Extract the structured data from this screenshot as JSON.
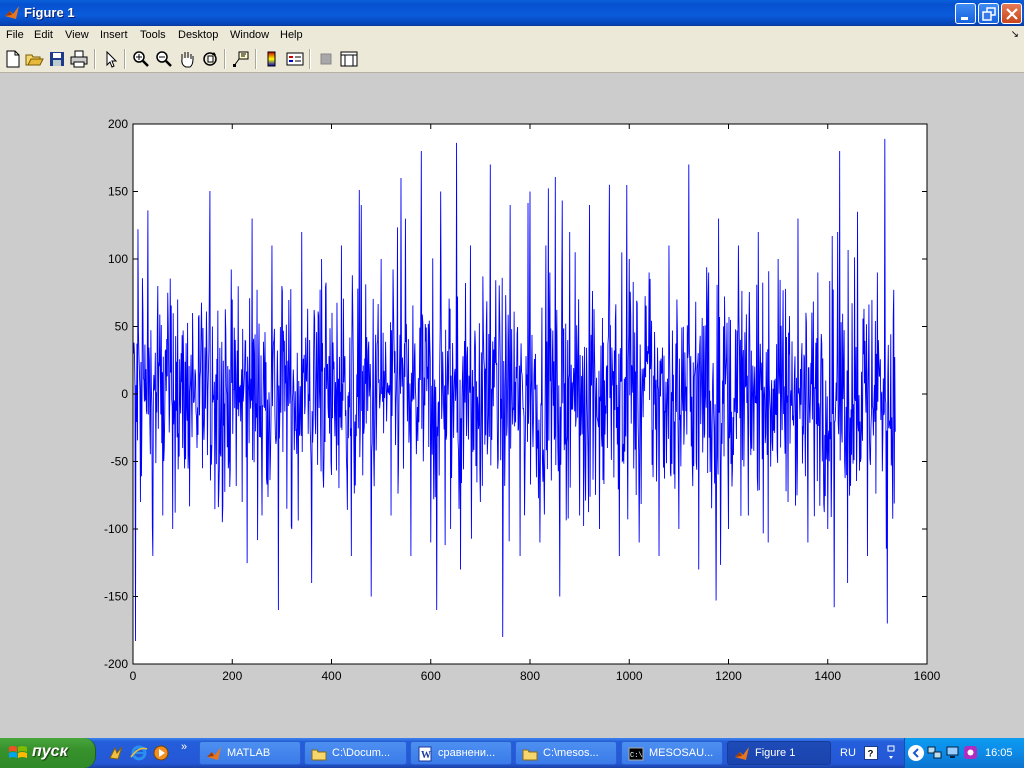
{
  "window": {
    "title": "Figure 1",
    "controls": [
      "minimize",
      "maximize",
      "close"
    ]
  },
  "menu": {
    "items": [
      "File",
      "Edit",
      "View",
      "Insert",
      "Tools",
      "Desktop",
      "Window",
      "Help"
    ]
  },
  "toolbar": {
    "buttons": [
      "new-figure",
      "open-file",
      "save",
      "print",
      "edit-plot",
      "zoom-in",
      "zoom-out",
      "pan",
      "rotate-3d",
      "data-cursor",
      "insert-colorbar",
      "insert-legend",
      "hide-plot-tools",
      "show-plot-tools"
    ]
  },
  "chart_data": {
    "type": "line",
    "color": "#0000ff",
    "xlim": [
      0,
      1600
    ],
    "ylim": [
      -200,
      200
    ],
    "xticks": [
      0,
      200,
      400,
      600,
      800,
      1000,
      1200,
      1400,
      1600
    ],
    "yticks": [
      200,
      150,
      100,
      50,
      0,
      -50,
      -100,
      -150,
      -200
    ],
    "x_range": [
      1,
      1536
    ],
    "series": [
      {
        "x": [
          1,
          5,
          10,
          15,
          20,
          30,
          40,
          50,
          60,
          70,
          80,
          90,
          100,
          120,
          140,
          160,
          180,
          200,
          220,
          240,
          260,
          280,
          293,
          300,
          320,
          340,
          360,
          380,
          400,
          420,
          440,
          460,
          480,
          500,
          520,
          540,
          560,
          580,
          600,
          612,
          620,
          640,
          652,
          660,
          680,
          700,
          720,
          745,
          760,
          780,
          800,
          820,
          840,
          860,
          880,
          900,
          920,
          940,
          960,
          980,
          1000,
          1020,
          1040,
          1060,
          1080,
          1100,
          1120,
          1140,
          1160,
          1175,
          1180,
          1200,
          1220,
          1240,
          1260,
          1280,
          1300,
          1320,
          1340,
          1360,
          1380,
          1400,
          1413,
          1420,
          1440,
          1460,
          1480,
          1500,
          1515,
          1520,
          1536
        ],
        "values": [
          30,
          -183,
          122,
          -80,
          60,
          136,
          -120,
          80,
          -90,
          75,
          -100,
          70,
          -40,
          60,
          -55,
          50,
          -95,
          70,
          -80,
          130,
          -90,
          110,
          -160,
          80,
          -100,
          120,
          -140,
          100,
          -60,
          110,
          -120,
          140,
          -150,
          100,
          -90,
          160,
          -120,
          70,
          -110,
          -160,
          150,
          -100,
          186,
          -130,
          110,
          -80,
          170,
          -180,
          140,
          -120,
          150,
          -110,
          90,
          -150,
          120,
          -90,
          140,
          -100,
          155,
          -120,
          100,
          -110,
          90,
          -120,
          110,
          -100,
          170,
          -130,
          90,
          -153,
          130,
          -100,
          110,
          -90,
          120,
          -110,
          100,
          -80,
          130,
          -110,
          90,
          -100,
          -158,
          120,
          -140,
          135,
          -120,
          90,
          189,
          -170,
          -28
        ]
      }
    ]
  },
  "taskbar": {
    "start_label": "пуск",
    "quicklaunch_more": "»",
    "tasks": [
      {
        "label": "MATLAB",
        "icon": "matlab-icon",
        "active": false
      },
      {
        "label": "C:\\Docum...",
        "icon": "folder-icon",
        "active": false
      },
      {
        "label": "сравнени...",
        "icon": "word-document-icon",
        "active": false
      },
      {
        "label": "C:\\mesos...",
        "icon": "folder-icon",
        "active": false
      },
      {
        "label": "MESOSAU...",
        "icon": "command-prompt-icon",
        "active": false
      },
      {
        "label": "Figure 1",
        "icon": "matlab-icon",
        "active": true
      }
    ],
    "language": "RU",
    "clock": "16:05"
  }
}
